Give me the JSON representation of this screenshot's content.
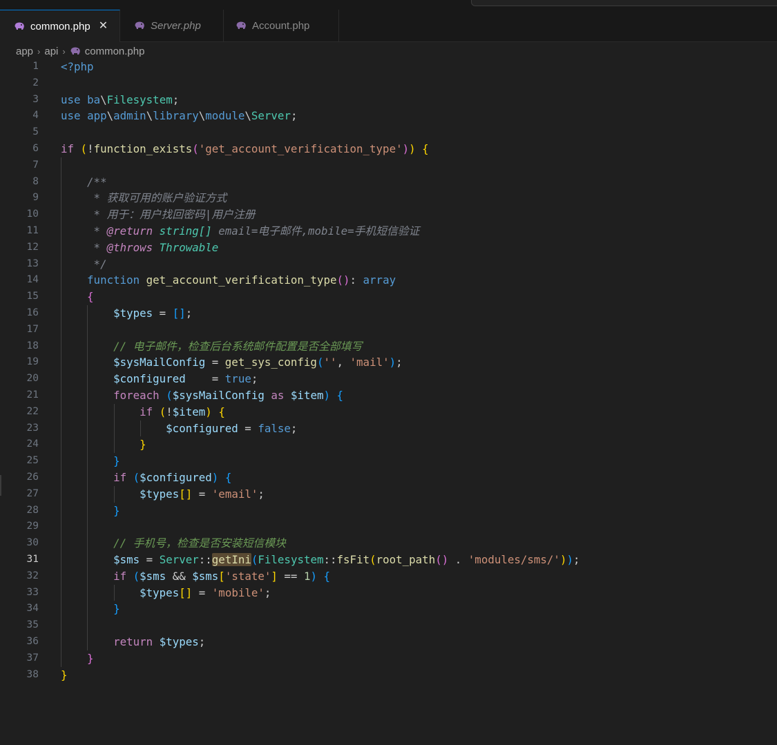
{
  "tabs": [
    {
      "label": "common.php",
      "active": true,
      "italic": false
    },
    {
      "label": "Server.php",
      "active": false,
      "italic": true
    },
    {
      "label": "Account.php",
      "active": false,
      "italic": false
    }
  ],
  "breadcrumb": {
    "parts": [
      "app",
      "api"
    ],
    "file": "common.php"
  },
  "current_line": 31,
  "colors": {
    "keyword": "#569cd6",
    "control": "#c586c0",
    "function": "#dcdcaa",
    "string": "#ce9178",
    "class": "#4ec9b0",
    "comment": "#6a9955",
    "bracket_1": "#ffd700",
    "bracket_2": "#da70d6",
    "bracket_3": "#179fff"
  },
  "code_lines": [
    "<?php",
    "",
    "use ba\\Filesystem;",
    "use app\\admin\\library\\module\\Server;",
    "",
    "if (!function_exists('get_account_verification_type')) {",
    "",
    "    /**",
    "     * 获取可用的账户验证方式",
    "     * 用于：用户找回密码|用户注册",
    "     * @return string[] email=电子邮件,mobile=手机短信验证",
    "     * @throws Throwable",
    "     */",
    "    function get_account_verification_type(): array",
    "    {",
    "        $types = [];",
    "",
    "        // 电子邮件，检查后台系统邮件配置是否全部填写",
    "        $sysMailConfig = get_sys_config('', 'mail');",
    "        $configured    = true;",
    "        foreach ($sysMailConfig as $item) {",
    "            if (!$item) {",
    "                $configured = false;",
    "            }",
    "        }",
    "        if ($configured) {",
    "            $types[] = 'email';",
    "        }",
    "",
    "        // 手机号，检查是否安装短信模块",
    "        $sms = Server::getIni(Filesystem::fsFit(root_path() . 'modules/sms/'));",
    "        if ($sms && $sms['state'] == 1) {",
    "            $types[] = 'mobile';",
    "        }",
    "",
    "        return $types;",
    "    }",
    "}"
  ]
}
